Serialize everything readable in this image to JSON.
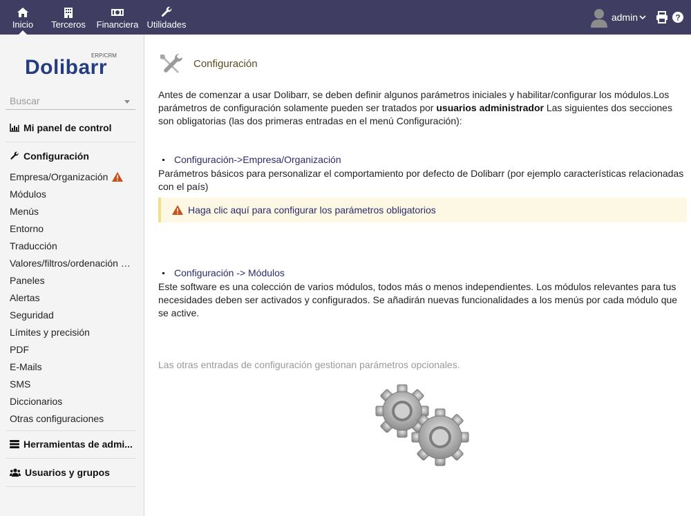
{
  "topnav": {
    "items": [
      {
        "label": "Inicio",
        "icon": "home-icon",
        "active": true
      },
      {
        "label": "Terceros",
        "icon": "building-icon"
      },
      {
        "label": "Financiera",
        "icon": "money-icon"
      },
      {
        "label": "Utilidades",
        "icon": "wrench-icon"
      }
    ],
    "user": "admin",
    "colors": {
      "bar": "#3f3e62"
    }
  },
  "sidebar": {
    "logo_text": "Dolibarr",
    "logo_sub": "ERP/CRM",
    "search_placeholder": "Buscar",
    "dashboard": "Mi panel de control",
    "config_title": "Configuración",
    "config_items": [
      "Empresa/Organización",
      "Módulos",
      "Menús",
      "Entorno",
      "Traducción",
      "Valores/filtros/ordenación p...",
      "Paneles",
      "Alertas",
      "Seguridad",
      "Límites y precisión",
      "PDF",
      "E-Mails",
      "SMS",
      "Diccionarios",
      "Otras configuraciones"
    ],
    "admin_tools": "Herramientas de admi...",
    "users_groups": "Usuarios y grupos"
  },
  "main": {
    "title": "Configuración",
    "intro_1": "Antes de comenzar a usar Dolibarr, se deben definir algunos parámetros iniciales y habilitar/configurar los módulos.Los parámetros de configuración solamente pueden ser tratados por ",
    "intro_bold": "usuarios administrador",
    "intro_2": " Las siguientes dos secciones son obligatorias (las dos primeras entradas en el menú Configuración):",
    "section1_link": "Configuración->Empresa/Organización",
    "section1_desc": "Parámetros básicos para personalizar el comportamiento por defecto de Dolibarr (por ejemplo características relacionadas con el país)",
    "warning_link": "Haga clic aquí para configurar los parámetros obligatorios",
    "section2_link": "Configuración -> Módulos",
    "section2_desc": "Este software es una colección de varios módulos, todos más o menos independientes. Los módulos relevantes para tus necesidades deben ser activados y configurados. Se añadirán nuevas funcionalidades a los menús por cada módulo que se active.",
    "optional_note": "Las otras entradas de configuración gestionan parámetros opcionales."
  }
}
